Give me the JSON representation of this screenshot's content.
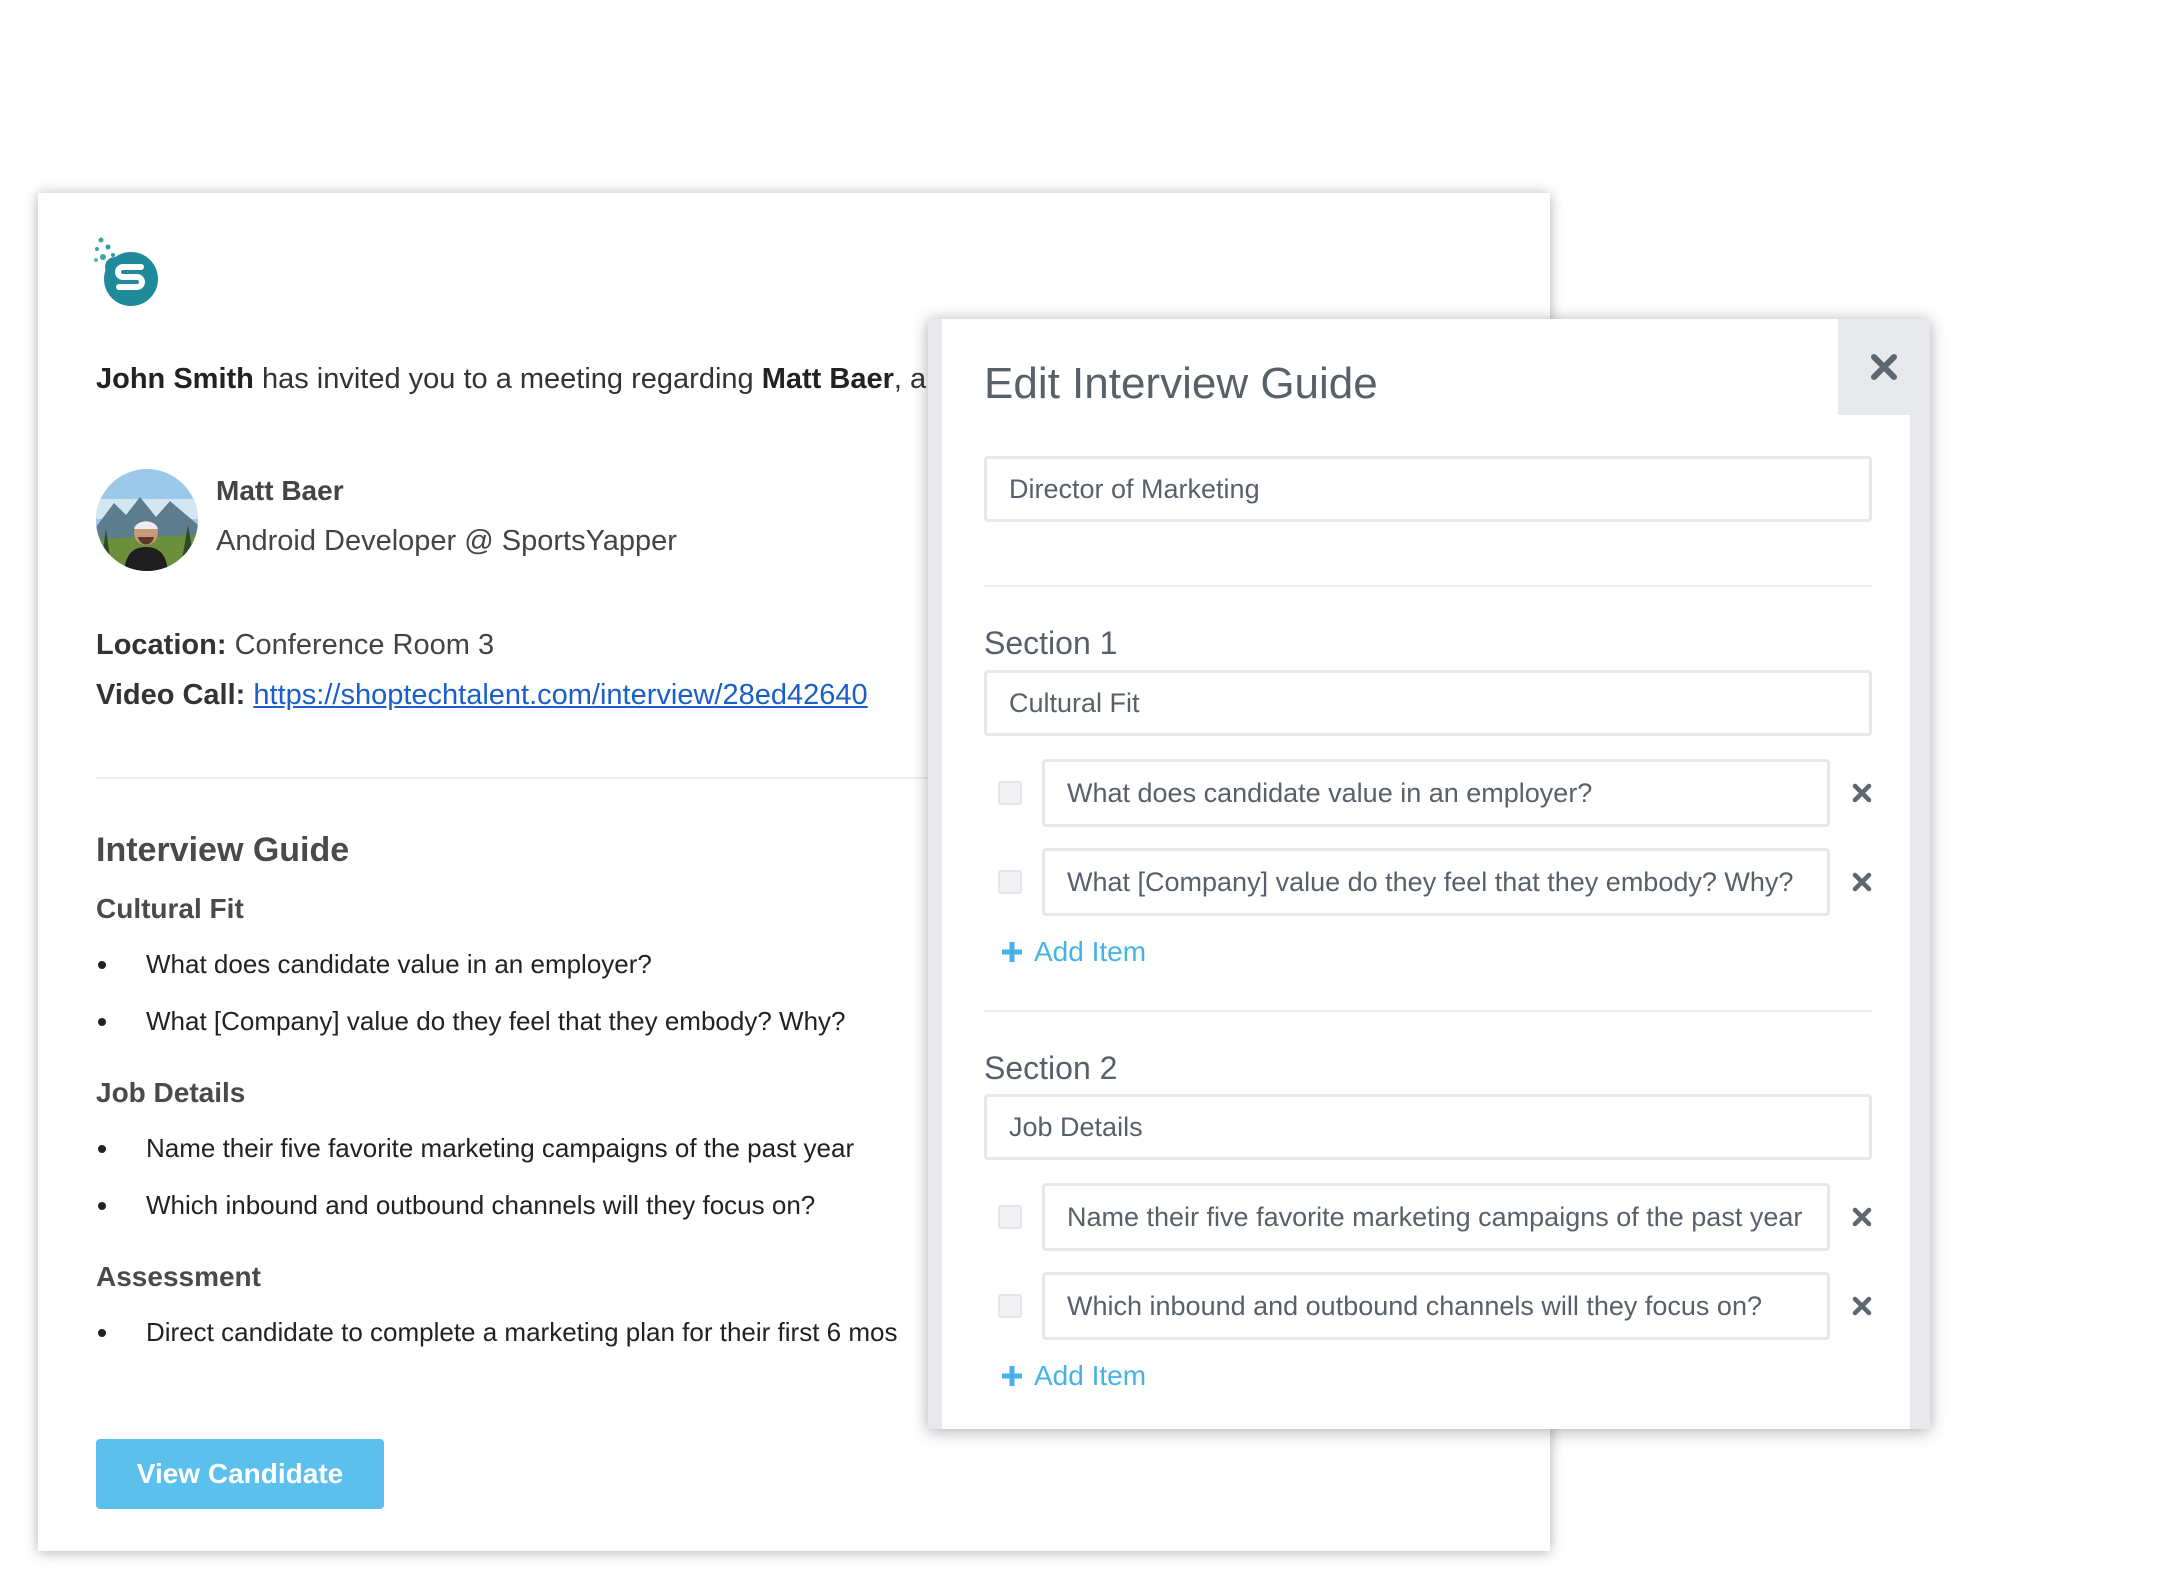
{
  "email": {
    "inviter": "John Smith",
    "invite_middle": "has invited you to a meeting regarding",
    "candidate_ref": "Matt Baer",
    "invite_tail": ", a c",
    "candidate": {
      "name": "Matt Baer",
      "role": "Android Developer @ SportsYapper"
    },
    "location_label": "Location:",
    "location": "Conference Room 3",
    "video_label": "Video Call:",
    "video_url": "https://shoptechtalent.com/interview/28ed42640",
    "guide_title": "Interview Guide",
    "sections": [
      {
        "title": "Cultural Fit",
        "items": [
          "What does candidate value in an employer?",
          "What [Company] value do they feel that they embody? Why?"
        ]
      },
      {
        "title": "Job Details",
        "items": [
          "Name their five favorite marketing campaigns of the past year",
          "Which inbound and outbound channels will they focus on?"
        ]
      },
      {
        "title": "Assessment",
        "items": [
          "Direct candidate to complete a marketing plan for their first 6 mos"
        ]
      }
    ],
    "view_button": "View Candidate"
  },
  "modal": {
    "title": "Edit Interview Guide",
    "guide_name": "Director of Marketing",
    "sections": [
      {
        "label": "Section 1",
        "name": "Cultural Fit",
        "items": [
          "What does candidate value in an employer?",
          "What [Company] value do they feel that they embody? Why?"
        ]
      },
      {
        "label": "Section 2",
        "name": "Job Details",
        "items": [
          "Name their five favorite marketing campaigns of the past year",
          "Which inbound and outbound channels will they focus on?"
        ]
      }
    ],
    "add_item": "Add Item"
  },
  "colors": {
    "accent_blue": "#5bc0eb",
    "link_blue": "#1a5fc9",
    "add_item_blue": "#47b3e5",
    "logo_teal": "#1f8a9a"
  },
  "icons": {
    "logo": "shoptechtalent-logo-icon",
    "close": "close-icon",
    "remove_item": "remove-item-icon",
    "add": "plus-icon"
  }
}
